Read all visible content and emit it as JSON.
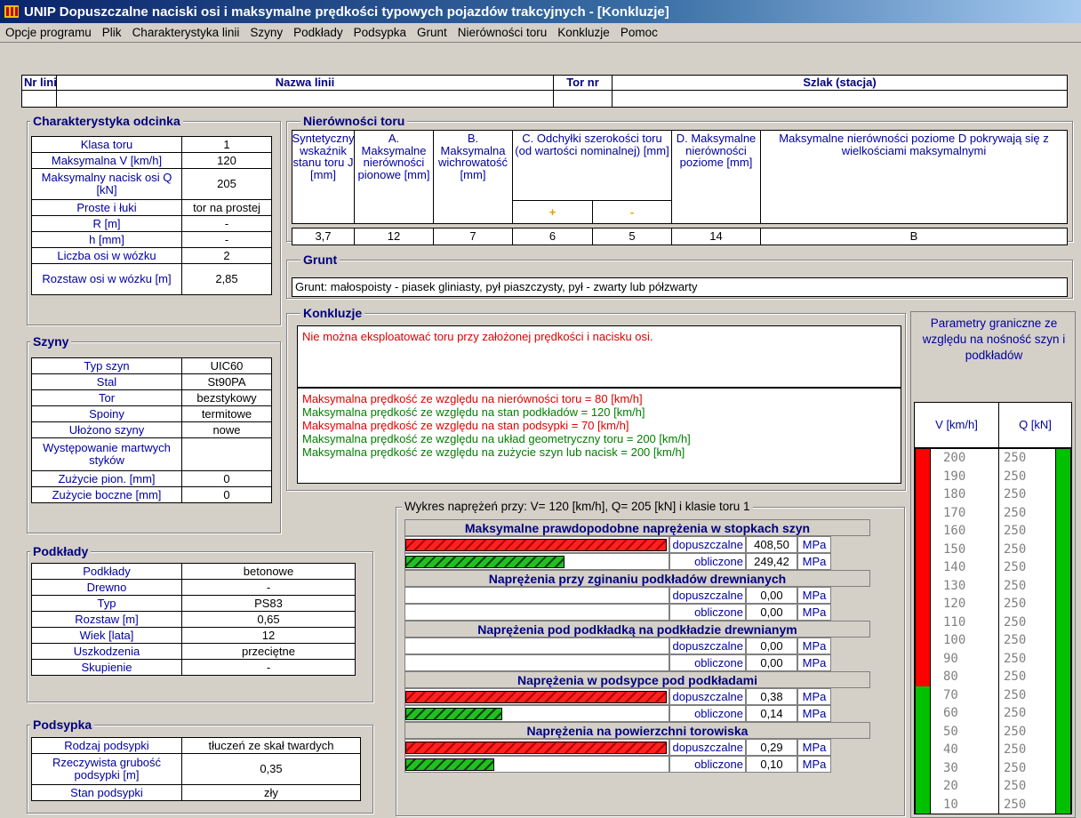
{
  "window": {
    "title": "UNIP Dopuszczalne naciski osi i maksymalne prędkości typowych pojazdów trakcyjnych - [Konkluzje]"
  },
  "menu": [
    "Opcje programu",
    "Plik",
    "Charakterystyka linii",
    "Szyny",
    "Podkłady",
    "Podsypka",
    "Grunt",
    "Nierówności toru",
    "Konkluzje",
    "Pomoc"
  ],
  "header": {
    "nr_linii_label": "Nr linii",
    "nazwa_linii_label": "Nazwa linii",
    "tor_nr_label": "Tor nr",
    "szlak_label": "Szlak (stacja)",
    "nr_linii_value": "",
    "nazwa_linii_value": "",
    "tor_nr_value": "",
    "szlak_value": ""
  },
  "charakterystyka": {
    "title": "Charakterystyka odcinka",
    "rows": [
      {
        "label": "Klasa toru",
        "value": "1"
      },
      {
        "label": "Maksymalna V [km/h]",
        "value": "120"
      },
      {
        "label": "Maksymalny nacisk osi  Q [kN]",
        "value": "205"
      },
      {
        "label": "Proste i łuki",
        "value": "tor na prostej"
      },
      {
        "label": "R [m]",
        "value": "-"
      },
      {
        "label": "h [mm]",
        "value": "-"
      },
      {
        "label": "Liczba osi w wózku",
        "value": "2"
      },
      {
        "label": "Rozstaw  osi w wózku [m]",
        "value": "2,85"
      }
    ]
  },
  "szyny": {
    "title": "Szyny",
    "rows": [
      {
        "label": "Typ szyn",
        "value": "UIC60"
      },
      {
        "label": "Stal",
        "value": "St90PA"
      },
      {
        "label": "Tor",
        "value": "bezstykowy"
      },
      {
        "label": "Spoiny",
        "value": "termitowe"
      },
      {
        "label": "Ułożono szyny",
        "value": "nowe"
      },
      {
        "label": "Występowanie martwych styków",
        "value": ""
      },
      {
        "label": "Zużycie pion. [mm]",
        "value": "0"
      },
      {
        "label": "Zużycie boczne [mm]",
        "value": "0"
      }
    ]
  },
  "podklady": {
    "title": "Podkłady",
    "rows": [
      {
        "label": "Podkłady",
        "value": "betonowe"
      },
      {
        "label": "Drewno",
        "value": "-"
      },
      {
        "label": "Typ",
        "value": "PS83"
      },
      {
        "label": "Rozstaw [m]",
        "value": "0,65"
      },
      {
        "label": "Wiek [lata]",
        "value": "12"
      },
      {
        "label": "Uszkodzenia",
        "value": "przeciętne"
      },
      {
        "label": "Skupienie",
        "value": "-"
      }
    ]
  },
  "podsypka": {
    "title": "Podsypka",
    "rows": [
      {
        "label": "Rodzaj podsypki",
        "value": "tłuczeń ze skał twardych"
      },
      {
        "label": "Rzeczywista grubość podsypki [m]",
        "value": "0,35"
      },
      {
        "label": "Stan podsypki",
        "value": "zły"
      }
    ]
  },
  "nierownosci": {
    "title": "Nierówności toru",
    "h_syntetyczny": "Syntetyczny wskaźnik stanu toru J [mm]",
    "h_a": "A. Maksymalne nierówności pionowe [mm]",
    "h_b": "B. Maksymalna wichrowatość [mm]",
    "h_c": "C. Odchyłki szerokości toru (od  wartości nominalnej) [mm]",
    "h_c_plus": "+",
    "h_c_minus": "-",
    "h_d": "D. Maksymalne nierówności poziome [mm]",
    "h_e": "Maksymalne nierówności poziome  D pokrywają się z wielkościami  maksymalnymi",
    "v_j": "3,7",
    "v_a": "12",
    "v_b": "7",
    "v_c_plus": "6",
    "v_c_minus": "5",
    "v_d": "14",
    "v_e": "B"
  },
  "grunt": {
    "title": "Grunt",
    "text": "Grunt: małospoisty - piasek gliniasty, pył piaszczysty, pył - zwarty lub półzwarty"
  },
  "konkluzje": {
    "title": "Konkluzje",
    "main": "Nie można eksploatować toru przy założonej prędkości i nacisku osi.",
    "lines": [
      {
        "text": "Maksymalna prędkość ze względu na nierówności toru = 80 [km/h]",
        "color": "#e00000"
      },
      {
        "text": "Maksymalna prędkość ze względu na stan podkładów = 120 [km/h]",
        "color": "#008000"
      },
      {
        "text": "Maksymalna prędkość ze względu na stan podsypki = 70 [km/h]",
        "color": "#e00000"
      },
      {
        "text": "Maksymalna prędkość ze względu na układ geometryczny toru = 200 [km/h]",
        "color": "#008000"
      },
      {
        "text": "Maksymalna prędkość ze względu na zużycie szyn lub nacisk = 200 [km/h]",
        "color": "#008000"
      }
    ]
  },
  "wykres": {
    "title": "Wykres naprężeń przy: V= 120 [km/h], Q= 205 [kN] i klasie toru  1",
    "unit": "MPa",
    "lbl_dop": "dopuszczalne",
    "lbl_obl": "obliczone",
    "sections": [
      {
        "title": "Maksymalne prawdopodobne naprężenia w stopkach szyn",
        "dop": "408,50",
        "obl": "249,42",
        "dop_frac": 1.0,
        "obl_frac": 0.61
      },
      {
        "title": "Naprężenia przy zginaniu podkładów drewnianych",
        "dop": "0,00",
        "obl": "0,00",
        "dop_frac": 0,
        "obl_frac": 0
      },
      {
        "title": "Naprężenia pod podkładką na podkładzie drewnianym",
        "dop": "0,00",
        "obl": "0,00",
        "dop_frac": 0,
        "obl_frac": 0
      },
      {
        "title": "Naprężenia w podsypce pod podkładami",
        "dop": "0,38",
        "obl": "0,14",
        "dop_frac": 1.0,
        "obl_frac": 0.37
      },
      {
        "title": "Naprężenia na powierzchni torowiska",
        "dop": "0,29",
        "obl": "0,10",
        "dop_frac": 1.0,
        "obl_frac": 0.34
      }
    ]
  },
  "parametry": {
    "title": "Parametry graniczne ze względu na nośność szyn i podkładów",
    "v_label": "V [km/h]",
    "q_label": "Q [kN]",
    "v_red_from": 80,
    "rows": [
      {
        "v": "200",
        "q": "250"
      },
      {
        "v": "190",
        "q": "250"
      },
      {
        "v": "180",
        "q": "250"
      },
      {
        "v": "170",
        "q": "250"
      },
      {
        "v": "160",
        "q": "250"
      },
      {
        "v": "150",
        "q": "250"
      },
      {
        "v": "140",
        "q": "250"
      },
      {
        "v": "130",
        "q": "250"
      },
      {
        "v": "120",
        "q": "250"
      },
      {
        "v": "110",
        "q": "250"
      },
      {
        "v": "100",
        "q": "250"
      },
      {
        "v": "90",
        "q": "250"
      },
      {
        "v": "80",
        "q": "250"
      },
      {
        "v": "70",
        "q": "250"
      },
      {
        "v": "60",
        "q": "250"
      },
      {
        "v": "50",
        "q": "250"
      },
      {
        "v": "40",
        "q": "250"
      },
      {
        "v": "30",
        "q": "250"
      },
      {
        "v": "20",
        "q": "250"
      },
      {
        "v": "10",
        "q": "250"
      }
    ]
  }
}
